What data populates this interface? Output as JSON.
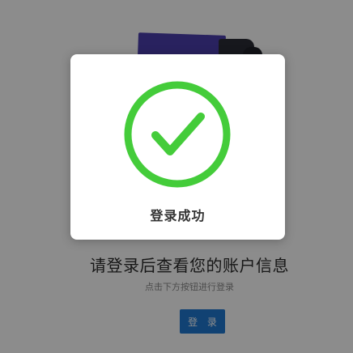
{
  "main": {
    "headline": "请登录后查看您的账户信息",
    "hint": "点击下方按钮进行登录",
    "login_button_label": "登 录"
  },
  "modal": {
    "message": "登录成功",
    "icon": "check-circle-icon",
    "icon_color": "#44cc3a"
  },
  "colors": {
    "overlay": "rgba(0,0,0,0.45)",
    "primary_button": "#1f78d1",
    "illustration_purple": "#4b3fae"
  }
}
